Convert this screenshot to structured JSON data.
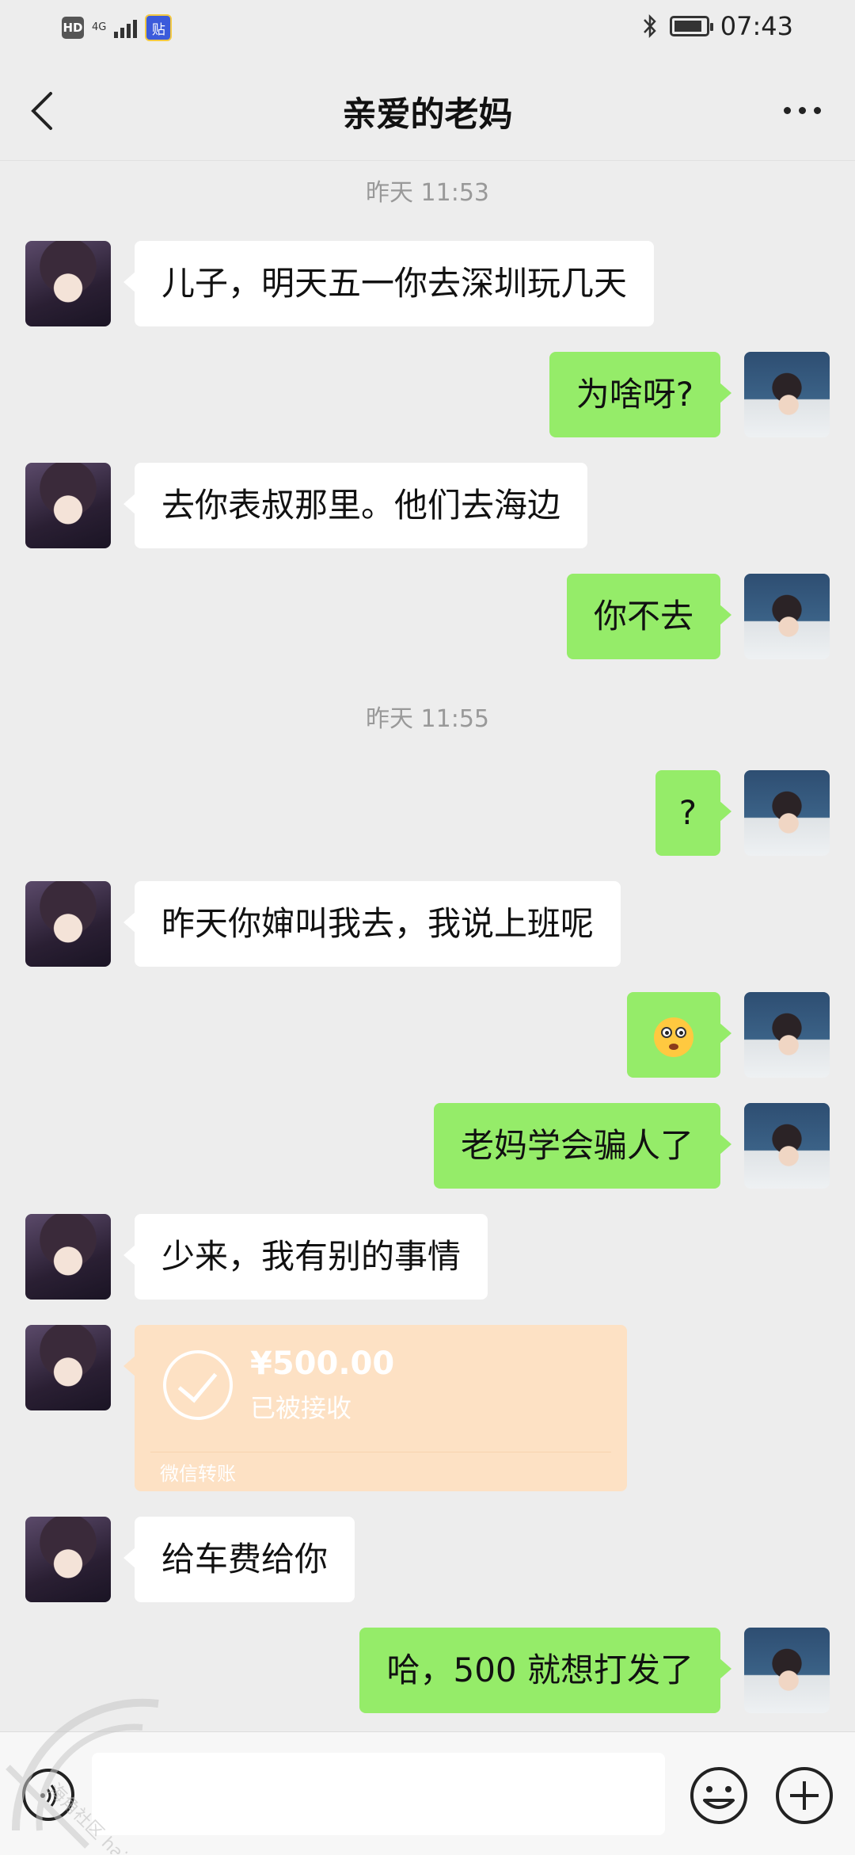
{
  "status_bar": {
    "hd": "HD",
    "network": "4G",
    "app_badge": "贴",
    "time": "07:43"
  },
  "nav": {
    "title": "亲爱的老妈"
  },
  "timestamps": [
    "昨天 11:53",
    "昨天 11:55"
  ],
  "messages": [
    {
      "from": "mom",
      "text": "儿子，明天五一你去深圳玩几天"
    },
    {
      "from": "me",
      "text": "为啥呀?"
    },
    {
      "from": "mom",
      "text": "去你表叔那里。他们去海边"
    },
    {
      "from": "me",
      "text": "你不去"
    },
    {
      "from": "me",
      "text": "?"
    },
    {
      "from": "mom",
      "text": "昨天你婶叫我去，我说上班呢"
    },
    {
      "from": "me",
      "emoji": "flushed-face"
    },
    {
      "from": "me",
      "text": "老妈学会骗人了"
    },
    {
      "from": "mom",
      "text": "少来，我有别的事情"
    },
    {
      "from": "mom",
      "text": "给车费给你"
    },
    {
      "from": "me",
      "text": "哈，500 就想打发了"
    }
  ],
  "transfer": {
    "amount": "¥500.00",
    "status": "已被接收",
    "label": "微信转账"
  },
  "watermark": {
    "text": "海角社区 haijiao.com"
  },
  "colors": {
    "background": "#ededed",
    "out_bubble": "#95ec69",
    "in_bubble": "#ffffff",
    "transfer_card": "#fde1c4"
  }
}
